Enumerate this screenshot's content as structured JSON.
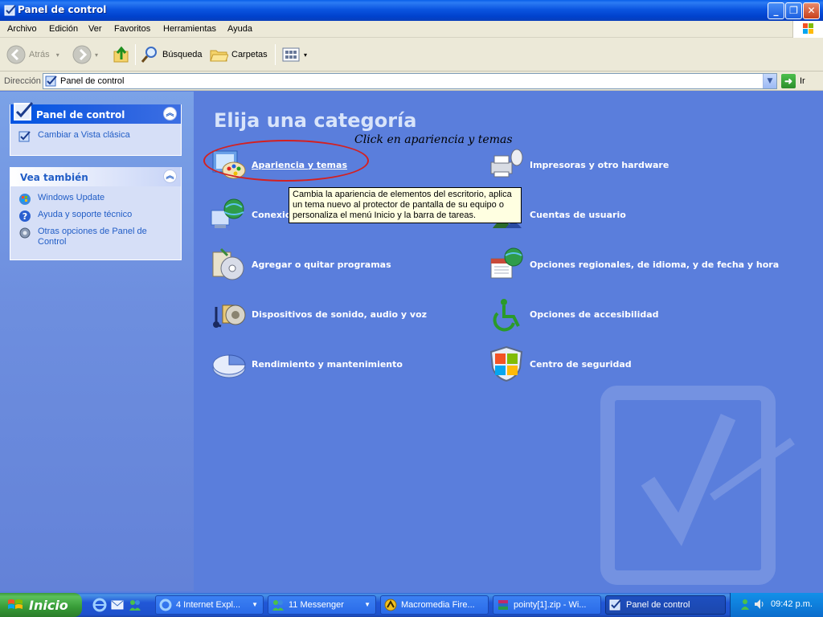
{
  "window": {
    "title": "Panel de control"
  },
  "menu": [
    "Archivo",
    "Edición",
    "Ver",
    "Favoritos",
    "Herramientas",
    "Ayuda"
  ],
  "toolbar": {
    "back_label": "Atrás",
    "search_label": "Búsqueda",
    "folders_label": "Carpetas"
  },
  "address": {
    "label": "Dirección",
    "value": "Panel de control",
    "go_label": "Ir"
  },
  "left_pane": {
    "panel1": {
      "title": "Panel de control",
      "links": [
        "Cambiar a Vista clásica"
      ]
    },
    "panel2": {
      "title": "Vea también",
      "links": [
        "Windows Update",
        "Ayuda y soporte técnico",
        "Otras opciones de Panel de Control"
      ]
    }
  },
  "main": {
    "heading": "Elija una categoría",
    "annotation": "Click en apariencia y temas",
    "categories": [
      "Apariencia y temas",
      "Conexiones de red e Internet",
      "Agregar o quitar programas",
      "Dispositivos de sonido, audio y voz",
      "Rendimiento y mantenimiento",
      "Impresoras y otro hardware",
      "Cuentas de usuario",
      "Opciones regionales, de idioma, y de fecha y hora",
      "Opciones de accesibilidad",
      "Centro de seguridad"
    ],
    "tooltip": "Cambia la apariencia de elementos del escritorio, aplica un tema nuevo al protector de pantalla de su equipo o personaliza el menú Inicio y la barra de tareas."
  },
  "taskbar": {
    "start_label": "Inicio",
    "tasks": [
      "4 Internet Expl...",
      "11 Messenger",
      "Macromedia Fire...",
      "pointy[1].zip - Wi...",
      "Panel de control"
    ],
    "clock": "09:42 p.m."
  },
  "colors": {
    "title_bar": "#0a55e0",
    "content_bg": "#5a7edc",
    "left_pane": "#7ba2e7",
    "start_button": "#3c9a3c",
    "annotation_circle": "#d42020",
    "tooltip_bg": "#ffffe1"
  }
}
